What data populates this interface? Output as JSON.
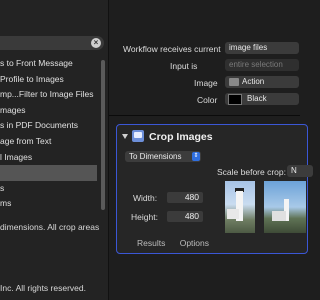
{
  "library": {
    "search_clear": "×",
    "items": [
      "s to Front Message",
      "Profile to Images",
      "mp...Filter to Image Files",
      "mages",
      "s in PDF Documents",
      "age from Text",
      "l Images",
      "",
      "s",
      "ms"
    ],
    "selected_index": 7,
    "description_lines": [
      "",
      "dimensions. All crop areas"
    ],
    "copyright": "Inc.  All rights reserved."
  },
  "workflow": {
    "receives_label": "Workflow receives current",
    "receives_value": "image files",
    "input_label": "Input is",
    "input_placeholder": "entire selection",
    "image_label": "Image",
    "image_value": "Action",
    "color_label": "Color",
    "color_value": "Black",
    "color_swatch": "#000000"
  },
  "action": {
    "title": "Crop Images",
    "mode": "To Dimensions",
    "scale_label": "Scale before crop:",
    "scale_value": "N",
    "width_label": "Width:",
    "width_value": "480",
    "height_label": "Height:",
    "height_value": "480",
    "tabs": [
      "Results",
      "Options"
    ],
    "accent": "#3b57d6"
  }
}
